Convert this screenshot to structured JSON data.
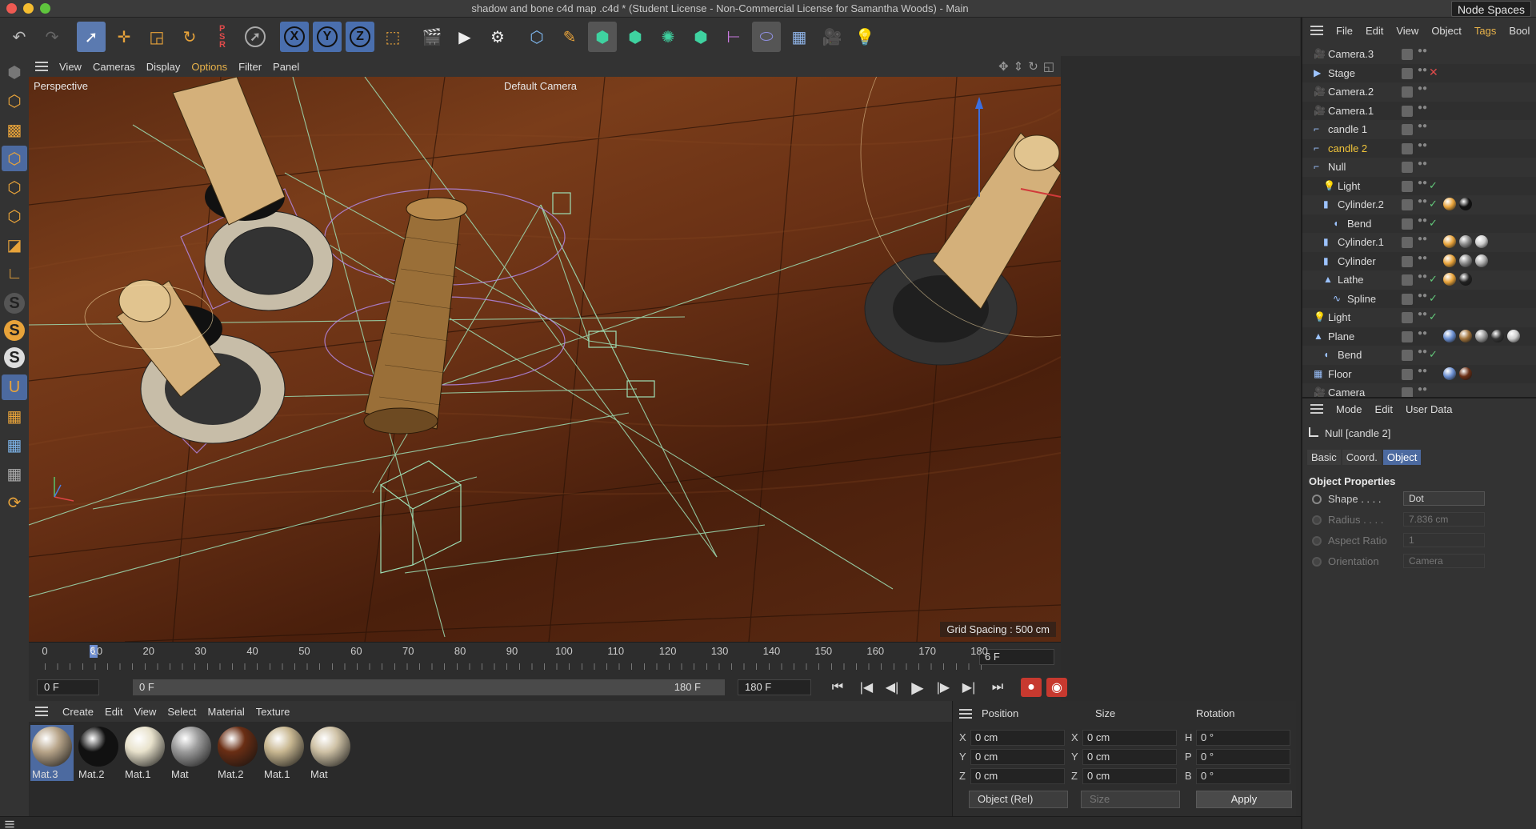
{
  "window": {
    "title": "shadow and bone c4d  map .c4d * (Student License - Non-Commercial License for Samantha Woods) - Main",
    "node_spaces": "Node Spaces"
  },
  "colors": {
    "accent": "#e8a33a",
    "selection": "#4c6aa0",
    "highlight_text": "#f0c43a",
    "check": "#63c97b"
  },
  "toolbar": {
    "axis_x": "X",
    "axis_y": "Y",
    "axis_z": "Z",
    "icons": [
      "undo-icon",
      "redo-icon",
      "select-icon",
      "move-icon",
      "scale-icon",
      "rotate-icon",
      "psr-icon",
      "live-select-icon",
      "x-lock-icon",
      "y-lock-icon",
      "z-lock-icon",
      "coordinate-system-icon",
      "render-region-icon",
      "render-view-icon",
      "render-settings-icon",
      "cube-icon",
      "pen-icon",
      "subdivision-icon",
      "extrude-icon",
      "mograph-icon",
      "array-icon",
      "deformer-icon",
      "field-icon",
      "floor-icon",
      "camera-icon",
      "light-icon"
    ]
  },
  "viewport": {
    "menu": [
      "View",
      "Cameras",
      "Display",
      "Options",
      "Filter",
      "Panel"
    ],
    "active_menu": "Options",
    "label": "Perspective",
    "camera": "Default Camera",
    "grid_spacing": "Grid Spacing : 500 cm"
  },
  "timeline": {
    "ticks": [
      "0",
      "10",
      "20",
      "30",
      "40",
      "50",
      "60",
      "70",
      "80",
      "90",
      "100",
      "110",
      "120",
      "130",
      "140",
      "150",
      "160",
      "170",
      "180"
    ],
    "current_frame_marker": "6",
    "end_field": "6 F"
  },
  "transport": {
    "start_field": "0 F",
    "range_start": "0 F",
    "range_end": "180 F",
    "end_field": "180 F"
  },
  "material_manager": {
    "menu": [
      "Create",
      "Edit",
      "View",
      "Select",
      "Material",
      "Texture"
    ],
    "materials": [
      {
        "label": "Mat.3",
        "color": "#b8a58a",
        "selected": true
      },
      {
        "label": "Mat.2",
        "color": "#111111",
        "selected": false
      },
      {
        "label": "Mat.1",
        "color": "#e8e2cc",
        "selected": false
      },
      {
        "label": "Mat",
        "color": "#9c9c9c",
        "selected": false
      },
      {
        "label": "Mat.2",
        "color": "#6a2e14",
        "selected": false
      },
      {
        "label": "Mat.1",
        "color": "#c9b892",
        "selected": false
      },
      {
        "label": "Mat",
        "color": "#cfc2a6",
        "selected": false
      }
    ]
  },
  "coordinates": {
    "headers": {
      "position": "Position",
      "size": "Size",
      "rotation": "Rotation"
    },
    "rows": [
      {
        "axis": "X",
        "pos": "0 cm",
        "size_axis": "X",
        "size": "0 cm",
        "rot_axis": "H",
        "rot": "0 °"
      },
      {
        "axis": "Y",
        "pos": "0 cm",
        "size_axis": "Y",
        "size": "0 cm",
        "rot_axis": "P",
        "rot": "0 °"
      },
      {
        "axis": "Z",
        "pos": "0 cm",
        "size_axis": "Z",
        "size": "0 cm",
        "rot_axis": "B",
        "rot": "0 °"
      }
    ],
    "mode": "Object (Rel)",
    "size_mode": "Size",
    "apply": "Apply"
  },
  "object_manager": {
    "menu": [
      "File",
      "Edit",
      "View",
      "Object",
      "Tags",
      "Bool"
    ],
    "active_menu": "Tags",
    "objects": [
      {
        "name": "Camera.3",
        "icon": "camera-icon",
        "indent": 0,
        "check": "none"
      },
      {
        "name": "Stage",
        "icon": "stage-icon",
        "indent": 0,
        "check": "x"
      },
      {
        "name": "Camera.2",
        "icon": "camera-icon",
        "indent": 0,
        "check": "none"
      },
      {
        "name": "Camera.1",
        "icon": "camera-icon",
        "indent": 0,
        "check": "none"
      },
      {
        "name": "candle 1",
        "icon": "null-icon",
        "indent": 0,
        "check": "none"
      },
      {
        "name": "candle 2",
        "icon": "null-icon",
        "indent": 0,
        "check": "none",
        "highlight": true
      },
      {
        "name": "Null",
        "icon": "null-icon",
        "indent": 0,
        "check": "none"
      },
      {
        "name": "Light",
        "icon": "light-icon",
        "indent": 1,
        "check": "check"
      },
      {
        "name": "Cylinder.2",
        "icon": "cylinder-icon",
        "indent": 1,
        "check": "check",
        "tags": [
          "#e8a33a",
          "#111111"
        ]
      },
      {
        "name": "Bend",
        "icon": "bend-icon",
        "indent": 2,
        "check": "check"
      },
      {
        "name": "Cylinder.1",
        "icon": "cylinder-icon",
        "indent": 1,
        "check": "none",
        "tags": [
          "#e8a33a",
          "#888888",
          "#cccccc"
        ]
      },
      {
        "name": "Cylinder",
        "icon": "cylinder-icon",
        "indent": 1,
        "check": "none",
        "tags": [
          "#e8a33a",
          "#888888",
          "#aaaaaa"
        ]
      },
      {
        "name": "Lathe",
        "icon": "lathe-icon",
        "indent": 1,
        "check": "check",
        "tags": [
          "#e8a33a",
          "#222222"
        ]
      },
      {
        "name": "Spline",
        "icon": "spline-icon",
        "indent": 2,
        "check": "check"
      },
      {
        "name": "Light",
        "icon": "light-icon",
        "indent": 0,
        "check": "check"
      },
      {
        "name": "Plane",
        "icon": "plane-icon",
        "indent": 0,
        "check": "none",
        "tags": [
          "#6a8ed0",
          "#a0723a",
          "#999999",
          "#333333",
          "#cccccc"
        ]
      },
      {
        "name": "Bend",
        "icon": "bend-icon",
        "indent": 1,
        "check": "check"
      },
      {
        "name": "Floor",
        "icon": "floor-icon",
        "indent": 0,
        "check": "none",
        "tags": [
          "#6a8ed0",
          "#6a2e14"
        ]
      },
      {
        "name": "Camera",
        "icon": "camera-icon",
        "indent": 0,
        "check": "none"
      }
    ]
  },
  "attribute_manager": {
    "menu": [
      "Mode",
      "Edit",
      "User Data"
    ],
    "title": "Null [candle 2]",
    "tabs": [
      "Basic",
      "Coord.",
      "Object"
    ],
    "active_tab": "Object",
    "section": "Object Properties",
    "props": [
      {
        "label": "Shape . . . .",
        "value": "Dot",
        "enabled": true,
        "dropdown": true
      },
      {
        "label": "Radius . . . .",
        "value": "7.836 cm",
        "enabled": false,
        "dropdown": false
      },
      {
        "label": "Aspect Ratio",
        "value": "1",
        "enabled": false,
        "dropdown": false
      },
      {
        "label": "Orientation",
        "value": "Camera",
        "enabled": false,
        "dropdown": true
      }
    ]
  }
}
